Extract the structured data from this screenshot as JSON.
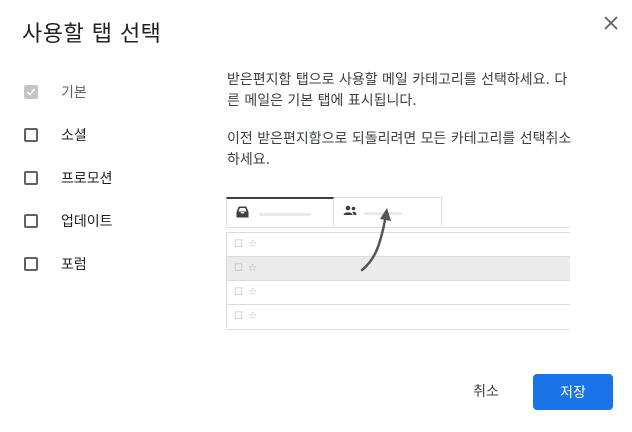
{
  "dialog": {
    "title": "사용할 탭 선택",
    "close_icon": "close-icon"
  },
  "categories": [
    {
      "label": "기본",
      "checked": true,
      "disabled": true
    },
    {
      "label": "소셜",
      "checked": false,
      "disabled": false
    },
    {
      "label": "프로모션",
      "checked": false,
      "disabled": false
    },
    {
      "label": "업데이트",
      "checked": false,
      "disabled": false
    },
    {
      "label": "포럼",
      "checked": false,
      "disabled": false
    }
  ],
  "description": {
    "para1": "받은편지함 탭으로 사용할 메일 카테고리를 선택하세요. 다른 메일은 기본 탭에 표시됩니다.",
    "para2": "이전 받은편지함으로 되돌리려면 모든 카테고리를 선택취소하세요."
  },
  "illustration": {
    "tab_icons": [
      "inbox-icon",
      "people-icon"
    ],
    "row_glyphs": [
      "☐",
      "☆"
    ]
  },
  "actions": {
    "cancel_label": "취소",
    "save_label": "저장",
    "save_color": "#1a73e8"
  }
}
